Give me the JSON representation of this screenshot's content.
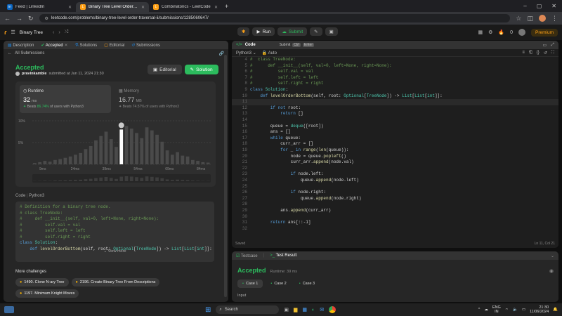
{
  "browser": {
    "tabs": [
      {
        "title": "Feed | LinkedIn",
        "color": "#0a66c2",
        "fav": "in"
      },
      {
        "title": "Binary Tree Level Order Travers...",
        "color": "#ffa116",
        "fav": "L"
      },
      {
        "title": "Combinatorics - LeetCode",
        "color": "#ffa116",
        "fav": "L"
      }
    ],
    "url": "leetcode.com/problems/binary-tree-level-order-traversal-ii/submissions/1285060647/"
  },
  "header": {
    "problem_list": "Binary Tree",
    "run": "Run",
    "submit": "Submit",
    "streak": "0",
    "premium": "Premium"
  },
  "left": {
    "tabs": [
      "Description",
      "Accepted",
      "Solutions",
      "Editorial",
      "Submissions"
    ],
    "back": "All Submissions",
    "status": "Accepted",
    "user": "pravinkamble",
    "submitted": "submitted at Jun 11, 2024 21:30",
    "editorial_btn": "Editorial",
    "solution_btn": "Solution",
    "runtime": {
      "label": "Runtime",
      "value": "32",
      "unit": "ms",
      "beats_label": "Beats",
      "beats_pct": "86.74%",
      "beats_rest": "of users with Python3"
    },
    "memory": {
      "label": "Memory",
      "value": "16.77",
      "unit": "MB",
      "beats_label": "Beats",
      "beats_pct": "74.57%",
      "beats_rest": "of users with Python3"
    },
    "code_header": "Code",
    "code_lang": "Python3",
    "code_lines": [
      "# Definition for a binary tree node.",
      "# class TreeNode:",
      "#     def __init__(self, val=0, left=None, right=None):",
      "#         self.val = val",
      "#         self.left = left",
      "#         self.right = right",
      "class Solution:",
      "    def levelOrderBottom(self, root: Optional[TreeNode]) -> List[List[int]]:"
    ],
    "view_more": "View more",
    "more_title": "More challenges",
    "challenges": [
      "1490. Clone N-ary Tree",
      "2196. Create Binary Tree From Descriptions",
      "1197. Minimum Knight Moves"
    ]
  },
  "chart_data": {
    "type": "bar",
    "y_ticks": [
      "10%",
      "5%",
      "0%"
    ],
    "x_ticks": [
      "9ms",
      "24ms",
      "39ms",
      "54ms",
      "69ms",
      "84ms"
    ],
    "values": [
      0.3,
      0.5,
      0.8,
      0.6,
      1.0,
      1.2,
      1.5,
      1.8,
      2.2,
      2.6,
      3.5,
      4.2,
      5.5,
      6.5,
      7.5,
      5.8,
      4.0,
      8.0,
      8.8,
      8.2,
      7.2,
      6.0,
      8.5,
      7.8,
      6.8,
      5.2,
      3.2,
      2.2,
      2.8,
      2.0,
      1.8,
      1.0,
      0.8,
      0.5,
      0.4
    ],
    "highlight_index": 17,
    "ylim": [
      0,
      10
    ]
  },
  "editor": {
    "title": "Code",
    "submit_hint": "Submit",
    "key1": "Ctrl",
    "key2": "Enter",
    "lang": "Python3",
    "auto": "Auto",
    "saved": "Saved",
    "cursor": "Ln 11, Col 21",
    "lines": [
      {
        "n": "4",
        "t": "#  class TreeNode:"
      },
      {
        "n": "5",
        "t": "#      def __init__(self, val=0, left=None, right=None):"
      },
      {
        "n": "6",
        "t": "#          self.val = val"
      },
      {
        "n": "7",
        "t": "#          self.left = left"
      },
      {
        "n": "8",
        "t": "#          self.right = right"
      },
      {
        "n": "9",
        "t": "class Solution:"
      },
      {
        "n": "10",
        "t": "    def levelOrderBottom(self, root: Optional[TreeNode]) -> List[List[int]]:"
      },
      {
        "n": "11",
        "t": ""
      },
      {
        "n": "12",
        "t": "        if not root:"
      },
      {
        "n": "13",
        "t": "            return []"
      },
      {
        "n": "14",
        "t": ""
      },
      {
        "n": "15",
        "t": "        queue = deque([root])"
      },
      {
        "n": "16",
        "t": "        ans = []"
      },
      {
        "n": "17",
        "t": "        while queue:"
      },
      {
        "n": "18",
        "t": "            curr_arr = []"
      },
      {
        "n": "19",
        "t": "            for _ in range(len(queue)):"
      },
      {
        "n": "20",
        "t": "                node = queue.popleft()"
      },
      {
        "n": "21",
        "t": "                curr_arr.append(node.val)"
      },
      {
        "n": "22",
        "t": ""
      },
      {
        "n": "23",
        "t": "                if node.left:"
      },
      {
        "n": "24",
        "t": "                    queue.append(node.left)"
      },
      {
        "n": "25",
        "t": ""
      },
      {
        "n": "26",
        "t": "                if node.right:"
      },
      {
        "n": "27",
        "t": "                    queue.append(node.right)"
      },
      {
        "n": "28",
        "t": ""
      },
      {
        "n": "29",
        "t": "            ans.append(curr_arr)"
      },
      {
        "n": "30",
        "t": ""
      },
      {
        "n": "31",
        "t": "        return ans[::-1]"
      },
      {
        "n": "32",
        "t": ""
      }
    ]
  },
  "result": {
    "testcase_tab": "Testcase",
    "result_tab": "Test Result",
    "status": "Accepted",
    "runtime": "Runtime: 39 ms",
    "cases": [
      "Case 1",
      "Case 2",
      "Case 3"
    ],
    "input_label": "Input"
  },
  "taskbar": {
    "search": "Search",
    "lang1": "ENG",
    "lang2": "IN",
    "time": "21:30",
    "date": "11/06/2024"
  }
}
